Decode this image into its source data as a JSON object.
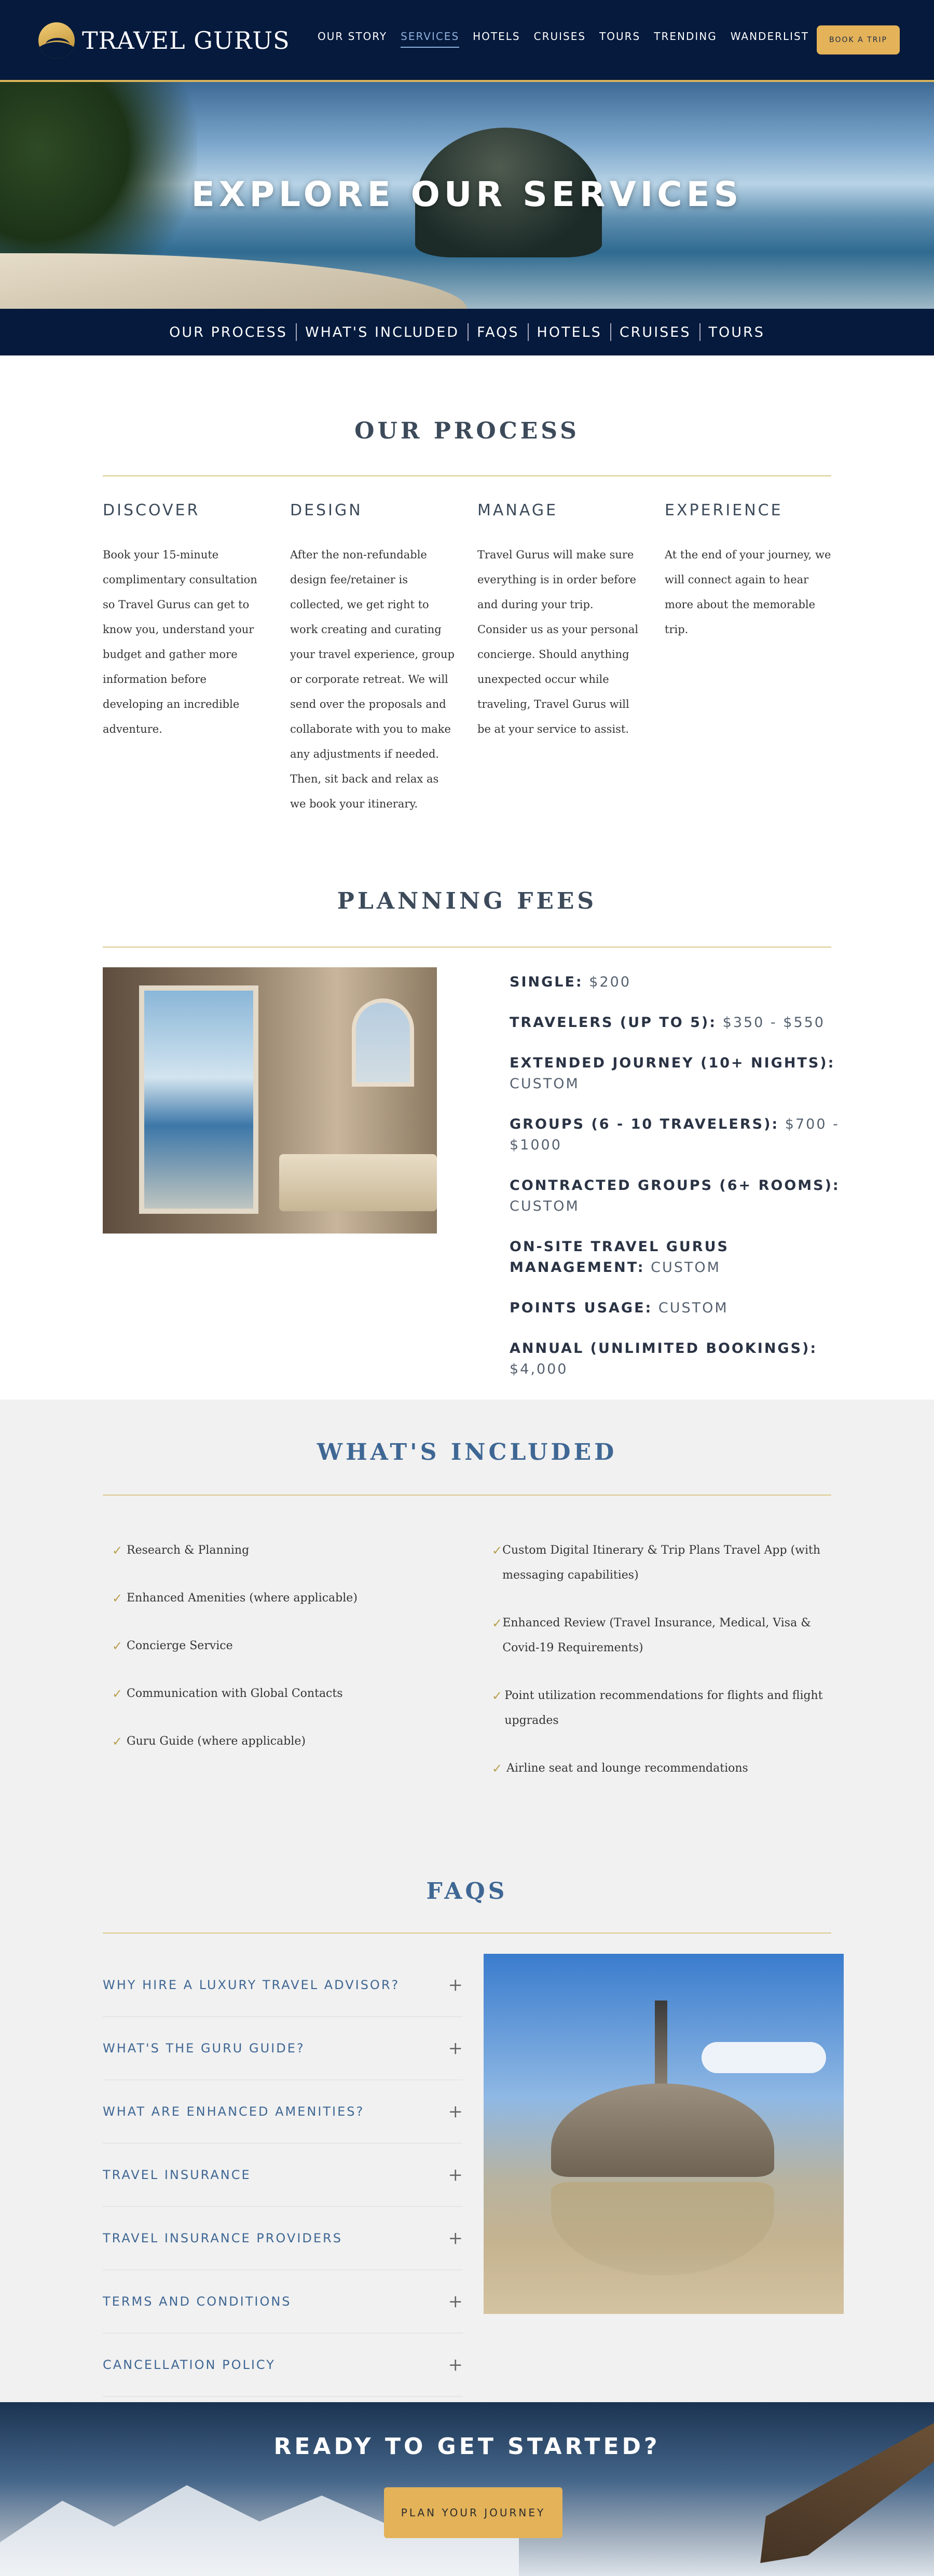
{
  "header": {
    "brand": "TRAVEL GURUS",
    "nav": [
      "OUR STORY",
      "SERVICES",
      "HOTELS",
      "CRUISES",
      "TOURS",
      "TRENDING",
      "WANDERLIST"
    ],
    "active_nav": "SERVICES",
    "book_label": "BOOK A TRIP"
  },
  "hero": {
    "title": "EXPLORE OUR SERVICES",
    "subnav": [
      "OUR PROCESS",
      "WHAT'S INCLUDED",
      "FAQS",
      "HOTELS",
      "CRUISES",
      "TOURS"
    ]
  },
  "process": {
    "title": "OUR PROCESS",
    "steps": [
      {
        "title": "DISCOVER",
        "text": "Book your 15-minute complimentary consultation so Travel Gurus can get to know you, understand your budget and gather more information before developing an incredible adventure."
      },
      {
        "title": "DESIGN",
        "text": "After the non-refundable design fee/retainer is collected, we get right to work creating and curating your travel experience, group or corporate retreat. We will send over the proposals and collaborate with you to make any adjustments if needed. Then, sit back and relax as we book your itinerary."
      },
      {
        "title": "MANAGE",
        "text": "Travel Gurus will make sure everything is in order before and during your trip. Consider us as your personal concierge. Should anything unexpected occur while traveling, Travel Gurus will be at your service to assist."
      },
      {
        "title": "EXPERIENCE",
        "text": "At the end of your journey, we will connect again to hear more about the memorable trip."
      }
    ]
  },
  "fees": {
    "title": "PLANNING FEES",
    "items": [
      {
        "label": "SINGLE:",
        "value": "$200"
      },
      {
        "label": "TRAVELERS (UP TO 5):",
        "value": "$350 - $550"
      },
      {
        "label": "EXTENDED JOURNEY (10+ NIGHTS):",
        "value": "CUSTOM"
      },
      {
        "label": "GROUPS (6 - 10 TRAVELERS):",
        "value": "$700 - $1000"
      },
      {
        "label": "CONTRACTED GROUPS (6+ ROOMS):",
        "value": "CUSTOM"
      },
      {
        "label": "ON-SITE TRAVEL GURUS MANAGEMENT:",
        "value": "CUSTOM"
      },
      {
        "label": "POINTS USAGE:",
        "value": "CUSTOM"
      },
      {
        "label": "ANNUAL (UNLIMITED BOOKINGS):",
        "value": "$4,000"
      }
    ]
  },
  "included": {
    "title": "WHAT'S INCLUDED",
    "left": [
      "Research & Planning",
      "Enhanced Amenities (where applicable)",
      "Concierge Service",
      "Communication with Global Contacts",
      "Guru Guide (where applicable)"
    ],
    "right": [
      "Custom Digital Itinerary & Trip Plans Travel App (with messaging capabilities)",
      "Enhanced Review (Travel Insurance, Medical, Visa & Covid-19 Requirements)",
      "Point utilization recommendations for flights and flight upgrades",
      "Airline seat and lounge recommendations"
    ]
  },
  "faqs": {
    "title": "FAQS",
    "items": [
      "WHY HIRE A LUXURY TRAVEL ADVISOR?",
      "WHAT'S THE GURU GUIDE?",
      "WHAT ARE ENHANCED AMENITIES?",
      "TRAVEL INSURANCE",
      "TRAVEL INSURANCE PROVIDERS",
      "TERMS AND CONDITIONS",
      "CANCELLATION POLICY"
    ]
  },
  "cta": {
    "title": "READY TO GET STARTED?",
    "button": "PLAN YOUR JOURNEY"
  },
  "colors": {
    "navy": "#051a3d",
    "gold": "#e3b259",
    "blue_heading": "#3f6794"
  }
}
